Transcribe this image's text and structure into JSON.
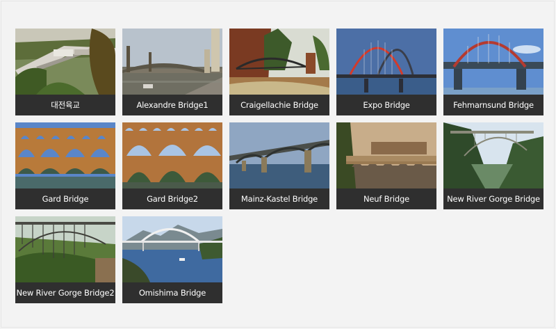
{
  "gallery": {
    "items": [
      {
        "caption": "대전육교",
        "icon": "bridge-photo"
      },
      {
        "caption": "Alexandre Bridge1",
        "icon": "bridge-photo"
      },
      {
        "caption": "Craigellachie Bridge",
        "icon": "bridge-photo"
      },
      {
        "caption": "Expo Bridge",
        "icon": "bridge-photo"
      },
      {
        "caption": "Fehmarnsund Bridge",
        "icon": "bridge-photo"
      },
      {
        "caption": "Gard Bridge",
        "icon": "bridge-photo"
      },
      {
        "caption": "Gard Bridge2",
        "icon": "bridge-photo"
      },
      {
        "caption": "Mainz-Kastel Bridge",
        "icon": "bridge-photo"
      },
      {
        "caption": "Neuf Bridge",
        "icon": "bridge-photo"
      },
      {
        "caption": "New River Gorge Bridge",
        "icon": "bridge-photo"
      },
      {
        "caption": "New River Gorge Bridge2",
        "icon": "bridge-photo"
      },
      {
        "caption": "Omishima Bridge",
        "icon": "bridge-photo"
      }
    ]
  }
}
